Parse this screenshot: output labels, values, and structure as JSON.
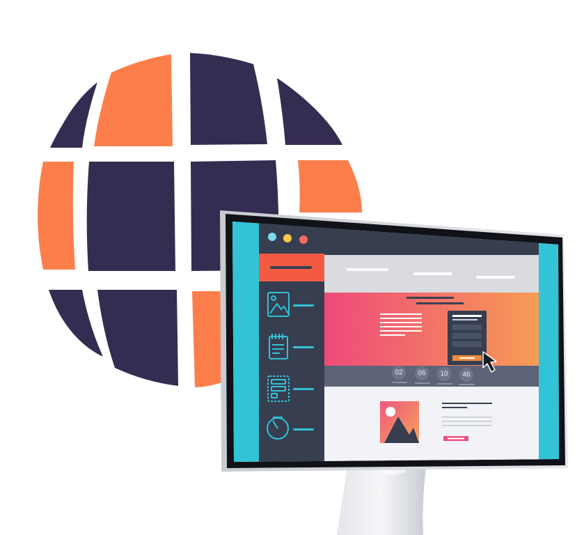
{
  "illustration": {
    "subject": "globe-and-desktop-monitor",
    "colors": {
      "globe_dark": "#352c52",
      "globe_orange": "#fc7f4b",
      "monitor_bezel": "#101218",
      "monitor_frame_silver": "#d7dadf",
      "teal_accent": "#32c3d6",
      "sidebar_dark": "#363e50",
      "sidebar_header_orange": "#f25b42",
      "hero_gradient_start": "#ee4a7a",
      "hero_gradient_end": "#f79c55",
      "cta_orange": "#f08a3a",
      "cta_pink": "#ec4f7e"
    }
  },
  "browser_window": {
    "traffic_lights": [
      "#7fd9e6",
      "#f8c94a",
      "#f26d5d"
    ]
  },
  "sidebar": {
    "items": [
      {
        "icon": "image-icon"
      },
      {
        "icon": "notepad-icon"
      },
      {
        "icon": "layout-icon"
      },
      {
        "icon": "gauge-icon"
      }
    ]
  },
  "countdown": {
    "values": [
      "02",
      "06",
      "10",
      "46"
    ]
  }
}
